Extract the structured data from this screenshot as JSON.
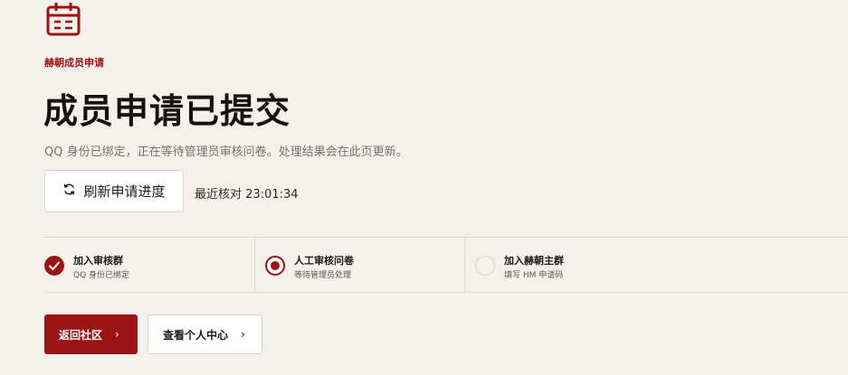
{
  "header": {
    "eyebrow": "赫朝成员申请",
    "title": "成员申请已提交",
    "description": "QQ 身份已绑定，正在等待管理员审核问卷。处理结果会在此页更新。"
  },
  "refresh": {
    "button_label": "刷新申请进度",
    "last_check": "最近核对 23:01:34"
  },
  "steps": [
    {
      "title": "加入审核群",
      "subtitle": "QQ 身份已绑定",
      "status": "done"
    },
    {
      "title": "人工审核问卷",
      "subtitle": "等待管理员处理",
      "status": "active"
    },
    {
      "title": "加入赫朝主群",
      "subtitle": "填写 HM 申请码",
      "status": "pending"
    }
  ],
  "actions": {
    "back_label": "返回社区",
    "profile_label": "查看个人中心",
    "chevron": "›"
  },
  "colors": {
    "accent": "#9b1414",
    "background": "#f4f1ec"
  }
}
